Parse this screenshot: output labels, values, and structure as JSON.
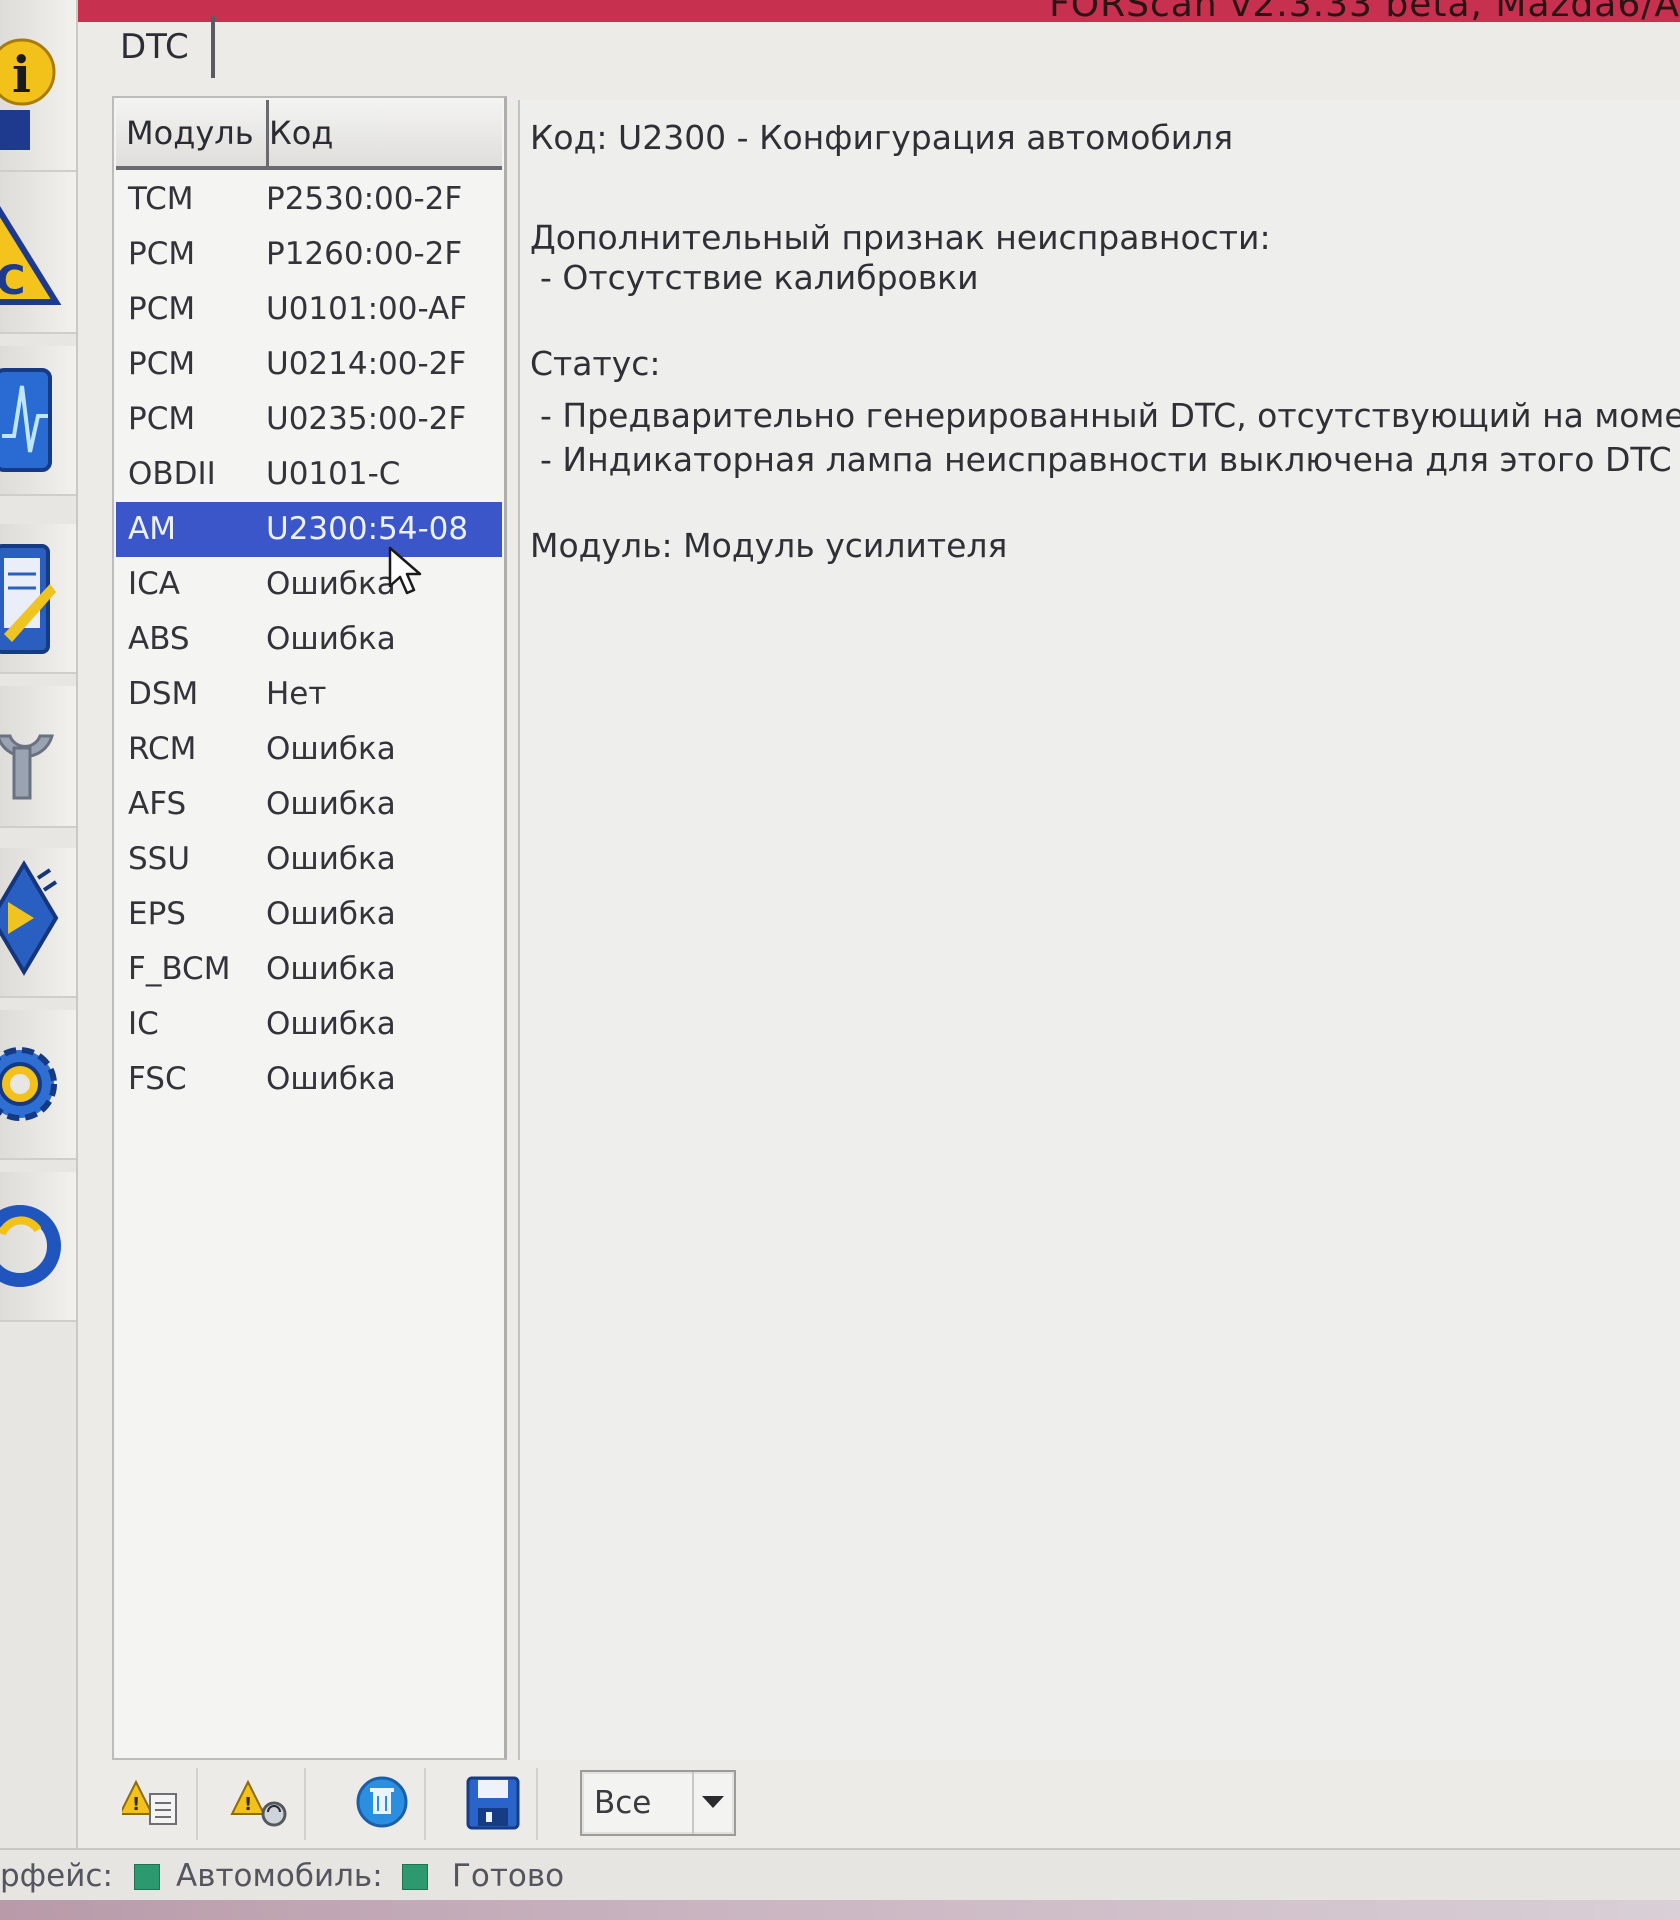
{
  "window": {
    "title": "FORScan v2.3.33 beta, Mazda6/A"
  },
  "tabs": {
    "dtc_label": "DTC"
  },
  "dtc_list": {
    "col_module": "Модуль",
    "col_code": "Код",
    "rows": [
      {
        "module": "TCM",
        "code": "P2530:00-2F"
      },
      {
        "module": "PCM",
        "code": "P1260:00-2F"
      },
      {
        "module": "PCM",
        "code": "U0101:00-AF"
      },
      {
        "module": "PCM",
        "code": "U0214:00-2F"
      },
      {
        "module": "PCM",
        "code": "U0235:00-2F"
      },
      {
        "module": "OBDII",
        "code": "U0101-C"
      },
      {
        "module": "AM",
        "code": "U2300:54-08"
      },
      {
        "module": "ICA",
        "code": "Ошибка"
      },
      {
        "module": "ABS",
        "code": "Ошибка"
      },
      {
        "module": "DSM",
        "code": "Нет"
      },
      {
        "module": "RCM",
        "code": "Ошибка"
      },
      {
        "module": "AFS",
        "code": "Ошибка"
      },
      {
        "module": "SSU",
        "code": "Ошибка"
      },
      {
        "module": "EPS",
        "code": "Ошибка"
      },
      {
        "module": "F_BCM",
        "code": "Ошибка"
      },
      {
        "module": "IC",
        "code": "Ошибка"
      },
      {
        "module": "FSC",
        "code": "Ошибка"
      }
    ]
  },
  "details": {
    "code_line": "Код: U2300 - Конфигурация автомобиля",
    "extra_header": "Дополнительный признак неисправности:",
    "extra_item": " - Отсутствие калибровки",
    "status_header": "Статус:",
    "status_item_1": " - Предварительно генерированный DTC, отсутствующий на момент за",
    "status_item_2": " - Индикаторная лампа неисправности выключена для этого DTC",
    "module_line": "Модуль: Модуль усилителя"
  },
  "toolbar": {
    "filter_value": "Все"
  },
  "statusbar": {
    "interface_label": "рфейс:",
    "vehicle_label": "Автомобиль:",
    "ready_label": "Готово"
  },
  "colors": {
    "selection": "#3a56c8",
    "status_ok": "#2c9a6e",
    "title_bar": "#c7304f"
  },
  "icons": {
    "sidebar": [
      "info-icon",
      "dtc-warning-icon",
      "oscilloscope-icon",
      "tests-clipboard-icon",
      "service-wrench-icon",
      "module-config-chip-icon",
      "settings-gear-icon",
      "help-lifebuoy-icon"
    ],
    "toolbar": [
      "dtc-report-icon",
      "dtc-read-icon",
      "clear-dtc-icon",
      "save-disk-icon"
    ]
  }
}
